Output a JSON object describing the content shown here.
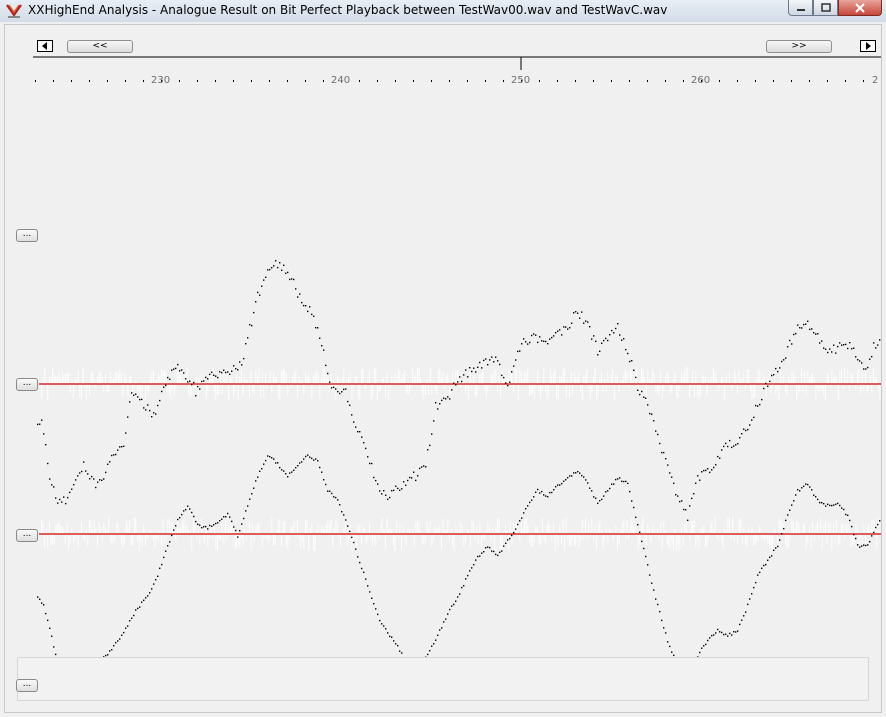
{
  "window": {
    "title": "XXHighEnd Analysis - Analogue Result on Bit Perfect Playback between TestWav00.wav and TestWavC.wav"
  },
  "navigation": {
    "back_label": "<<",
    "forward_label": ">>"
  },
  "ruler": {
    "tick_labels": [
      "230",
      "240",
      "250",
      "260",
      "2"
    ],
    "current_marker": "250"
  },
  "side_buttons": {
    "label": "..."
  },
  "colors": {
    "reference_line": "#d40000",
    "trace": "#000000",
    "difference_bars": "#ffffff",
    "background": "#f0f0f0"
  },
  "icons": {
    "app": "xx-logo-icon",
    "minimize": "minimize-icon",
    "maximize": "maximize-icon",
    "close": "close-icon",
    "left": "left-arrow-icon",
    "right": "right-arrow-icon"
  }
}
